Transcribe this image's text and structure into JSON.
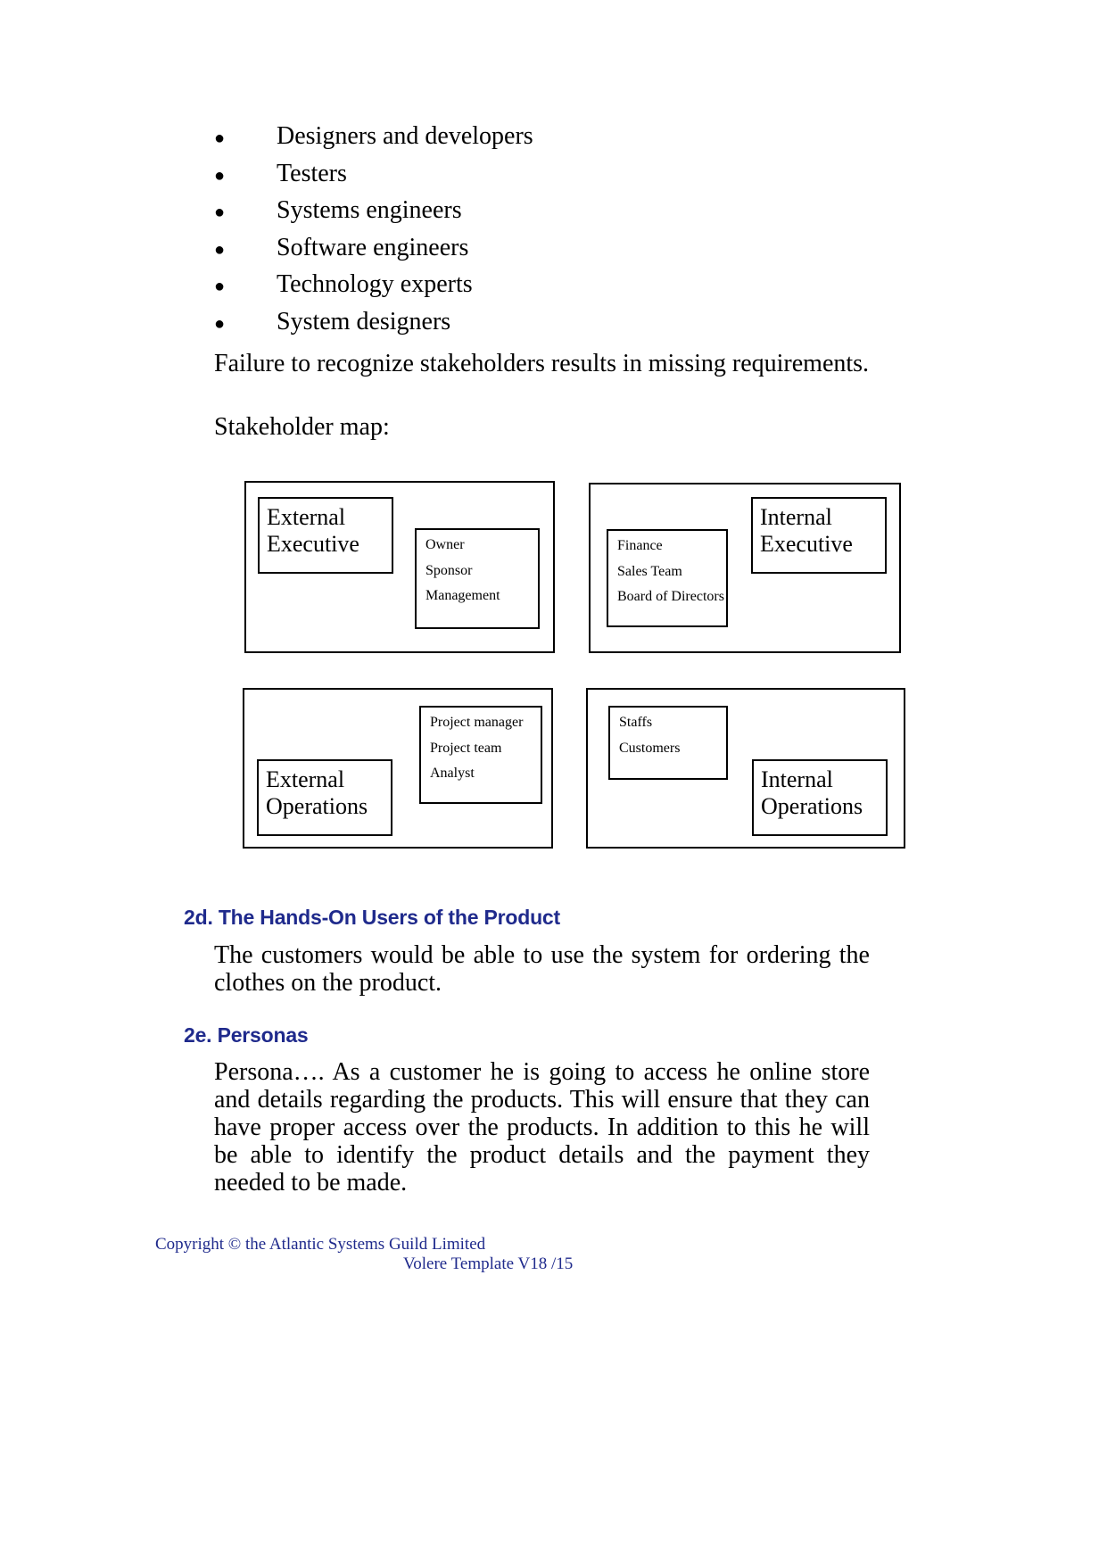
{
  "stakeholder_bullets": [
    {
      "bullet": "●",
      "label": "Designers and developers"
    },
    {
      "bullet": "●",
      "label": "Testers"
    },
    {
      "bullet": "●",
      "label": "Systems engineers"
    },
    {
      "bullet": "●",
      "label": "Software engineers"
    },
    {
      "bullet": "●",
      "label": "Technology experts"
    },
    {
      "bullet": "●",
      "label": "System designers"
    }
  ],
  "paragraphs": {
    "failure": "Failure to recognize stakeholders results in missing requirements.",
    "stakeholder_map_label": "Stakeholder map:"
  },
  "stakeholder_map": {
    "quadrants": [
      {
        "id": "external-executive",
        "label": "External Executive",
        "items": [
          "Owner",
          "Sponsor",
          "Management"
        ]
      },
      {
        "id": "internal-executive",
        "label": "Internal Executive",
        "items": [
          "Finance",
          "Sales Team",
          "Board of Directors"
        ]
      },
      {
        "id": "external-operations",
        "label": "External Operations",
        "items": [
          "Project manager",
          "Project team",
          "Analyst"
        ]
      },
      {
        "id": "internal-operations",
        "label": "Internal Operations",
        "items": [
          "Staffs",
          "Customers"
        ]
      }
    ]
  },
  "sections": [
    {
      "id": "2d",
      "heading": "2d. The Hands-On Users of the Product",
      "body": "The customers would be able to use the system for ordering the clothes on the product."
    },
    {
      "id": "2e",
      "heading": "2e. Personas",
      "body": "Persona…. As a customer he is going to access he online store and details regarding the products. This will ensure that they can have proper access over the products. In addition to this he will be able to identify the product details and the payment they needed to be made."
    }
  ],
  "footer": {
    "copyright": "Copyright © the Atlantic Systems Guild Limited",
    "template": "Volere Template V18 /15"
  },
  "colors": {
    "heading": "#1f2a8c",
    "footer": "#1f2a8c",
    "text": "#000000",
    "rule": "#000000"
  }
}
